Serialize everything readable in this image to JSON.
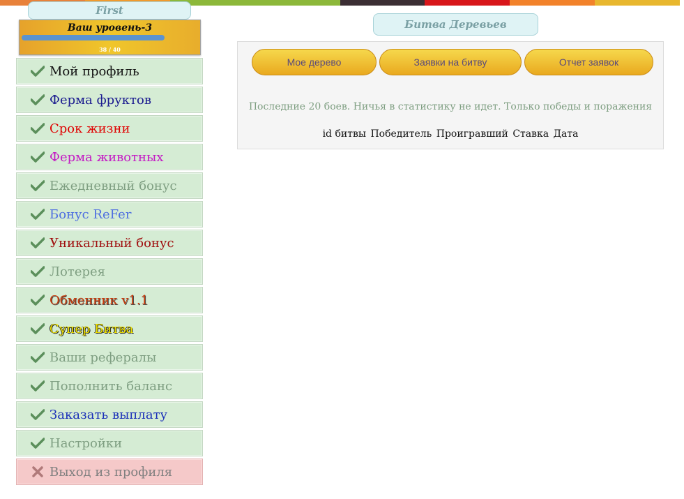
{
  "topbar_colors": [
    "#e8813a",
    "#f19a2e",
    "#8cb83a",
    "#8cb83a",
    "#3b2e34",
    "#d8161b",
    "#f2822a",
    "#e8b72e"
  ],
  "sidebar": {
    "tab_title": "First",
    "level": {
      "title": "Ваш уровень-3",
      "count": "38 / 40",
      "progress": 0.95
    },
    "items": [
      {
        "label": "Мой профиль",
        "color": "#111111"
      },
      {
        "label": "Ферма фруктов",
        "color": "#1a1a8f"
      },
      {
        "label": "Срок жизни",
        "color": "#e00000"
      },
      {
        "label": "Ферма животных",
        "color": "#c41ac4"
      },
      {
        "label": "Ежедневный бонус",
        "color": "#7f9f82"
      },
      {
        "label": "Бонус ReFer",
        "color": "#4f6fe0"
      },
      {
        "label": "Уникальный бонус",
        "color": "#a01010"
      },
      {
        "label": "Лотерея",
        "color": "#7f9f82"
      },
      {
        "label": "Обменник v1.1",
        "color": "#c83a0a"
      },
      {
        "label": "Супер Битва",
        "color": "#f2e400"
      },
      {
        "label": "Ваши рефералы",
        "color": "#7f9f82"
      },
      {
        "label": "Пополнить баланс",
        "color": "#7f9f82"
      },
      {
        "label": "Заказать выплату",
        "color": "#1a2fb8"
      },
      {
        "label": "Настройки",
        "color": "#7f9f82"
      }
    ],
    "exit_label": "Выход из профиля"
  },
  "main": {
    "tab_title": "Битва Деревьев",
    "buttons": [
      "Мое дерево",
      "Заявки на битву",
      "Отчет заявок"
    ],
    "note": "Последние 20 боев. Ничья в статистику не идет. Только победы и поражения",
    "columns": [
      "id битвы",
      "Победитель",
      "Проигравший",
      "Ставка",
      "Дата"
    ]
  }
}
